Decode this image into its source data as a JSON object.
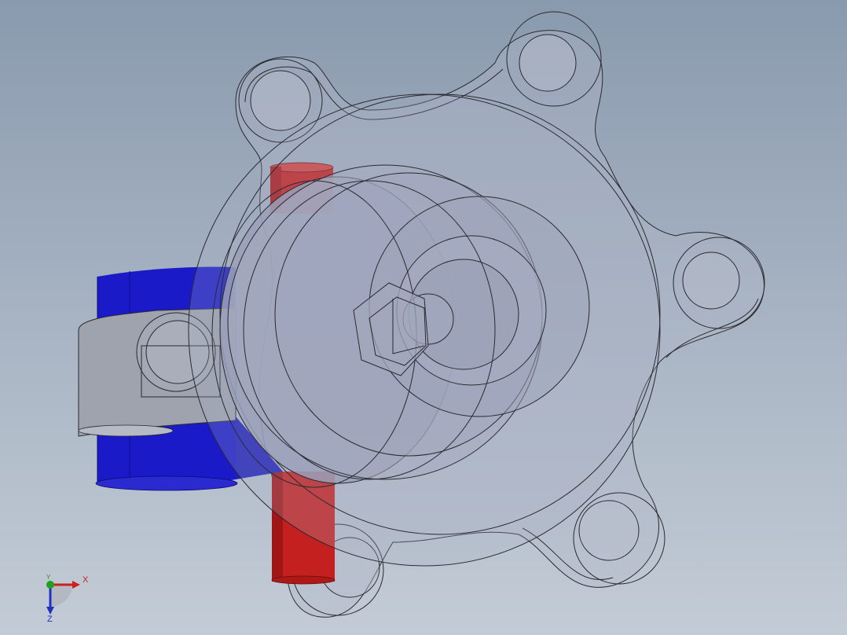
{
  "viewport": {
    "background_top": "#8a9aae",
    "background_bottom": "#c3ccd6"
  },
  "model": {
    "body_color": "#9aa0b8",
    "edge_color": "#2a2a30",
    "clamp_color": "#1a1ac8",
    "pin_color": "#c42020",
    "band_color": "#9ea3ae",
    "flange_color": "#b3b8c8"
  },
  "triad": {
    "x_label": "X",
    "y_label": "Y",
    "z_label": "Z",
    "x_color": "#cc2020",
    "y_color": "#20a020",
    "z_color": "#2030c0"
  }
}
